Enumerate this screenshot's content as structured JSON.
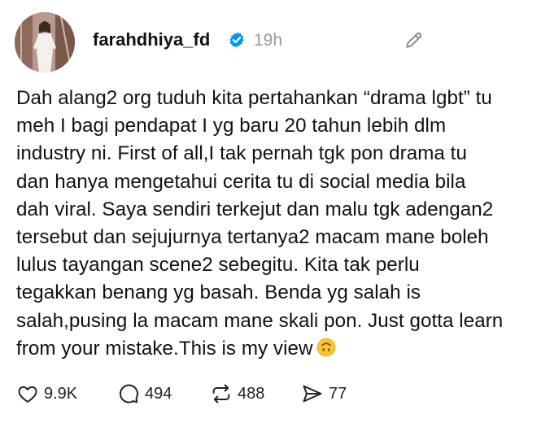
{
  "post": {
    "username": "farahdhiya_fd",
    "time": "19h",
    "lines": [
      "Dah alang2 org tuduh kita pertahankan “drama lgbt” tu",
      "meh I bagi pendapat I yg baru 20 tahun lebih dlm",
      "industry ni. First of all,I tak pernah tgk pon drama tu",
      "dan hanya mengetahui cerita tu di social media bila",
      "dah viral. Saya sendiri terkejut dan malu tgk adengan2",
      "tersebut dan sejujurnya tertanya2 macam mane boleh",
      "lulus tayangan scene2 sebegitu. Kita tak perlu",
      "tegakkan benang yg basah. Benda yg salah is",
      "salah,pusing la macam mane skali pon. Just gotta learn",
      "from your mistake.This is my view"
    ],
    "emoji": "upside-down-face",
    "stats": {
      "likes": "9.9K",
      "replies": "494",
      "reposts": "488",
      "shares": "77"
    }
  },
  "icons": {
    "verified": "verified-badge-icon",
    "edit": "pencil-icon",
    "like": "heart-icon",
    "reply": "comment-icon",
    "repost": "repost-icon",
    "share": "send-icon"
  },
  "colors": {
    "verified": "#0095f6",
    "time": "#9a9a9a",
    "text": "#111111"
  }
}
